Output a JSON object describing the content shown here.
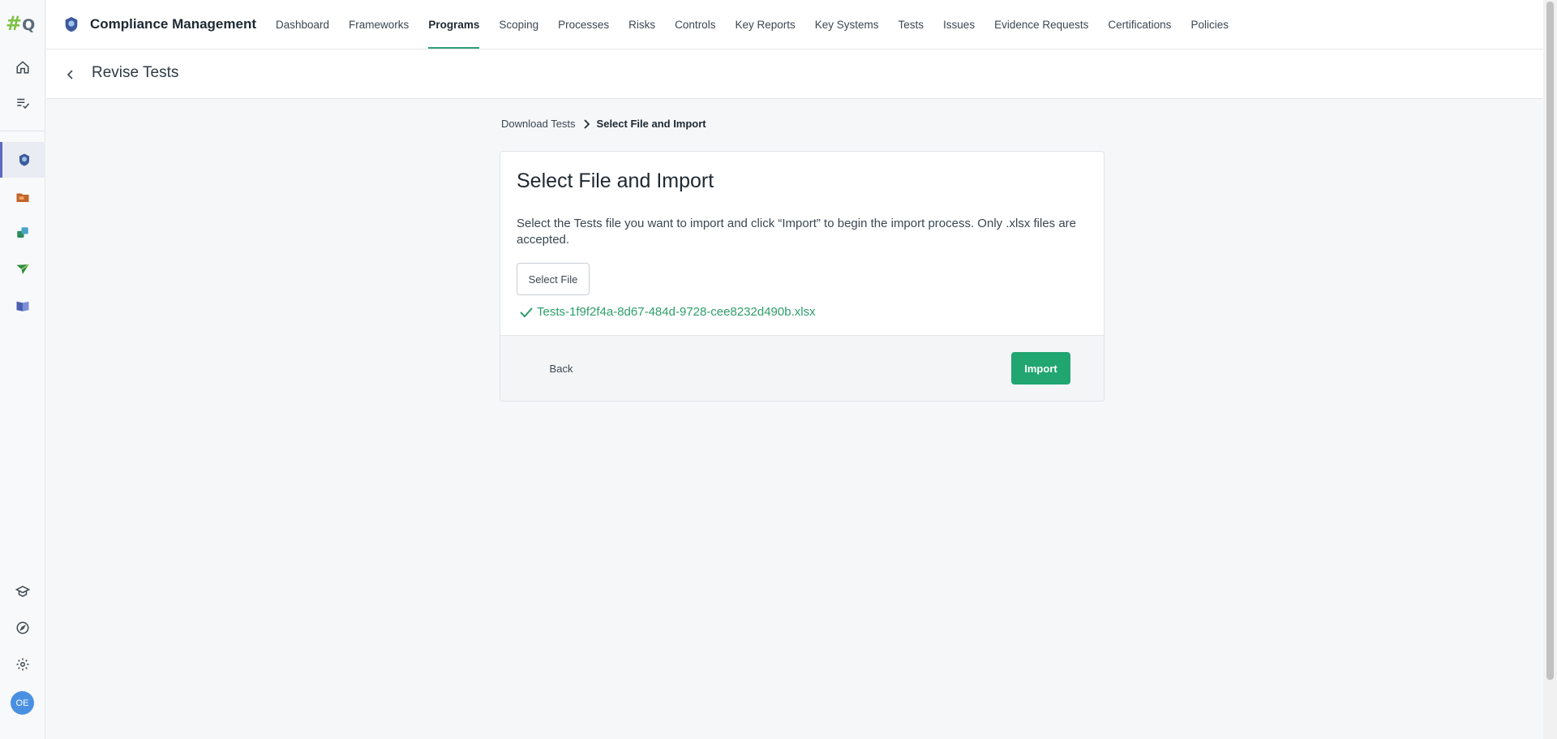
{
  "logo": {
    "hash": "#",
    "q": "Q"
  },
  "rail": {
    "items": [
      {
        "name": "home-icon"
      },
      {
        "name": "tasks-icon"
      },
      {
        "name": "compliance-icon"
      },
      {
        "name": "folder-icon"
      },
      {
        "name": "sync-icon"
      },
      {
        "name": "send-icon"
      },
      {
        "name": "book-icon"
      }
    ],
    "bottom": [
      {
        "name": "learning-icon"
      },
      {
        "name": "explore-icon"
      },
      {
        "name": "settings-icon"
      }
    ],
    "avatar_initials": "OE"
  },
  "header": {
    "brand_title": "Compliance Management",
    "nav": [
      {
        "label": "Dashboard"
      },
      {
        "label": "Frameworks"
      },
      {
        "label": "Programs"
      },
      {
        "label": "Scoping"
      },
      {
        "label": "Processes"
      },
      {
        "label": "Risks"
      },
      {
        "label": "Controls"
      },
      {
        "label": "Key Reports"
      },
      {
        "label": "Key Systems"
      },
      {
        "label": "Tests"
      },
      {
        "label": "Issues"
      },
      {
        "label": "Evidence Requests"
      },
      {
        "label": "Certifications"
      },
      {
        "label": "Policies"
      }
    ],
    "active_nav": "Programs"
  },
  "subheader": {
    "title": "Revise Tests"
  },
  "breadcrumb": {
    "step1": "Download Tests",
    "step2": "Select File and Import"
  },
  "card": {
    "title": "Select File and Import",
    "description": "Select the Tests file you want to import and click “Import” to begin the import process. Only .xlsx files are accepted.",
    "select_file_label": "Select File",
    "file_name": "Tests-1f9f2f4a-8d67-484d-9728-cee8232d490b.xlsx",
    "back_label": "Back",
    "import_label": "Import"
  },
  "colors": {
    "accent_green": "#21a672",
    "success_text": "#2e9e6a",
    "avatar_blue": "#4a90e2"
  }
}
